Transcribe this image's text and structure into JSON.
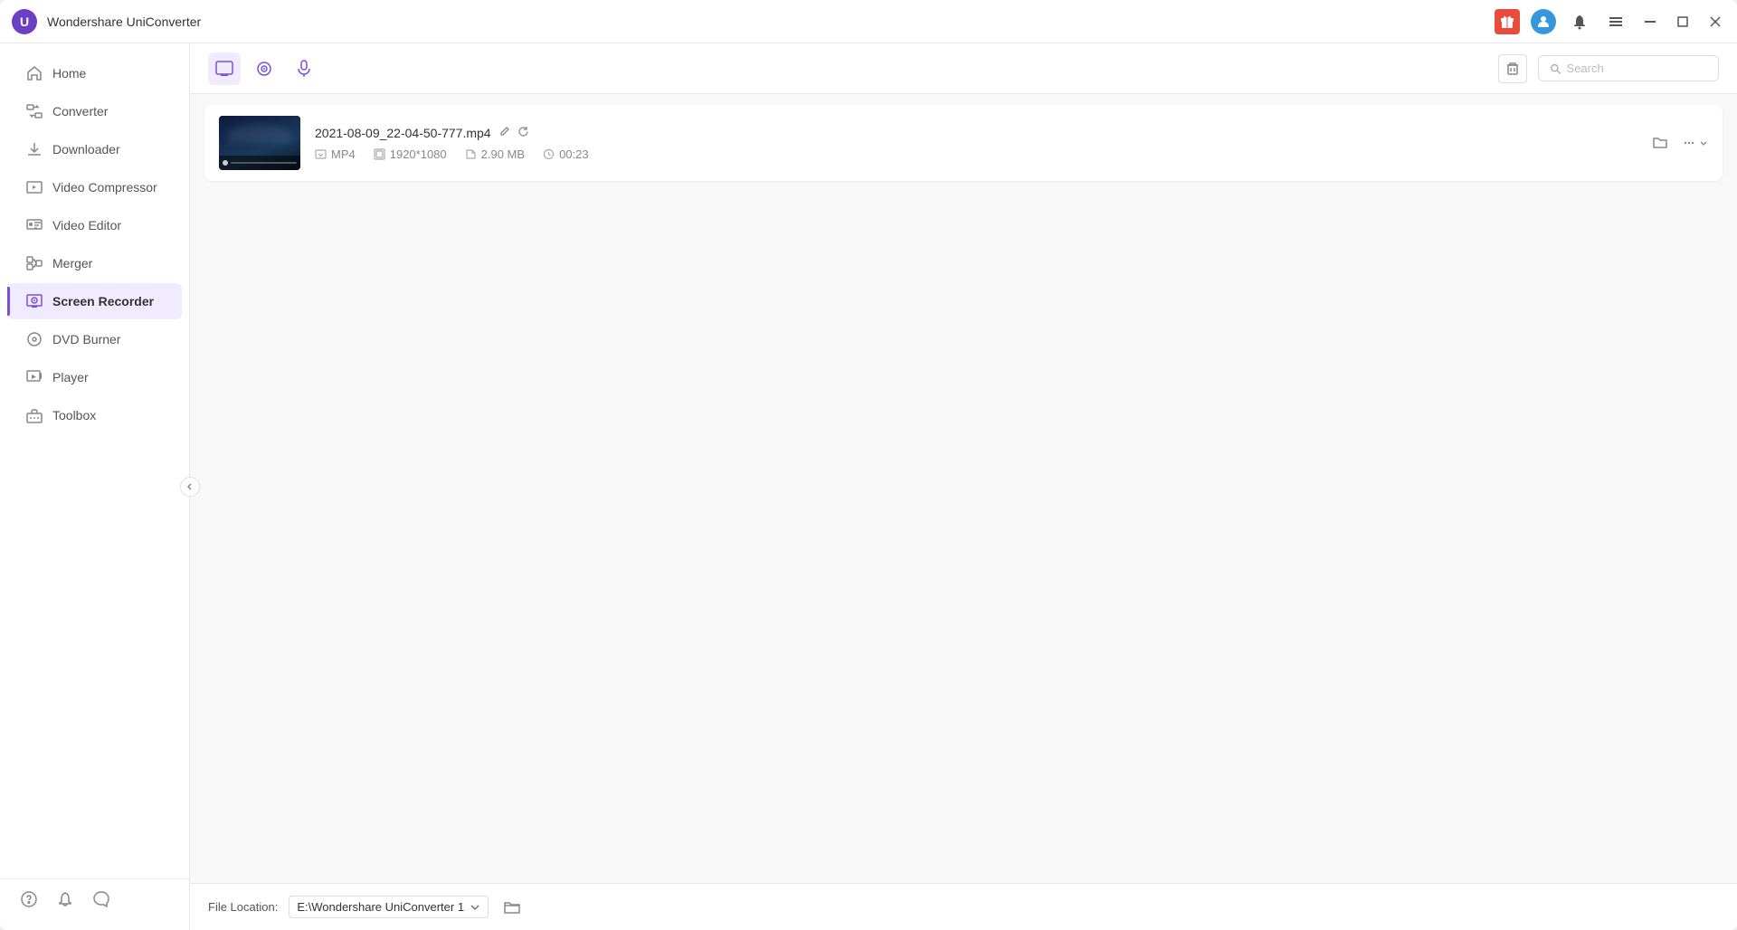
{
  "app": {
    "title": "Wondershare UniConverter",
    "logo_alt": "UniConverter Logo"
  },
  "titlebar": {
    "gift_icon": "🎁",
    "user_icon": "👤",
    "bell_icon": "🔔",
    "menu_icon": "☰",
    "minimize_icon": "—",
    "restore_icon": "❐",
    "close_icon": "✕"
  },
  "sidebar": {
    "items": [
      {
        "id": "home",
        "label": "Home",
        "icon": "home"
      },
      {
        "id": "converter",
        "label": "Converter",
        "icon": "converter"
      },
      {
        "id": "downloader",
        "label": "Downloader",
        "icon": "downloader"
      },
      {
        "id": "video-compressor",
        "label": "Video Compressor",
        "icon": "compress"
      },
      {
        "id": "video-editor",
        "label": "Video Editor",
        "icon": "edit"
      },
      {
        "id": "merger",
        "label": "Merger",
        "icon": "merge"
      },
      {
        "id": "screen-recorder",
        "label": "Screen Recorder",
        "icon": "record",
        "active": true
      },
      {
        "id": "dvd-burner",
        "label": "DVD Burner",
        "icon": "dvd"
      },
      {
        "id": "player",
        "label": "Player",
        "icon": "player"
      },
      {
        "id": "toolbox",
        "label": "Toolbox",
        "icon": "toolbox"
      }
    ],
    "bottom_icons": [
      "help",
      "notification",
      "feedback"
    ]
  },
  "toolbar": {
    "tabs": [
      {
        "id": "screen",
        "icon": "screen",
        "active": true
      },
      {
        "id": "camera",
        "icon": "camera"
      },
      {
        "id": "audio",
        "icon": "audio"
      }
    ],
    "search_placeholder": "Search"
  },
  "files": [
    {
      "name": "2021-08-09_22-04-50-777.mp4",
      "format": "MP4",
      "resolution": "1920*1080",
      "size": "2.90 MB",
      "duration": "00:23",
      "thumb_gradient": "linear-gradient(160deg, #0d1b3e 0%, #1a3a5c 60%, #0a1628 100%)"
    }
  ],
  "bottom": {
    "file_location_label": "File Location:",
    "location_value": "E:\\Wondershare UniConverter 1",
    "location_dropdown_icon": "▾"
  }
}
